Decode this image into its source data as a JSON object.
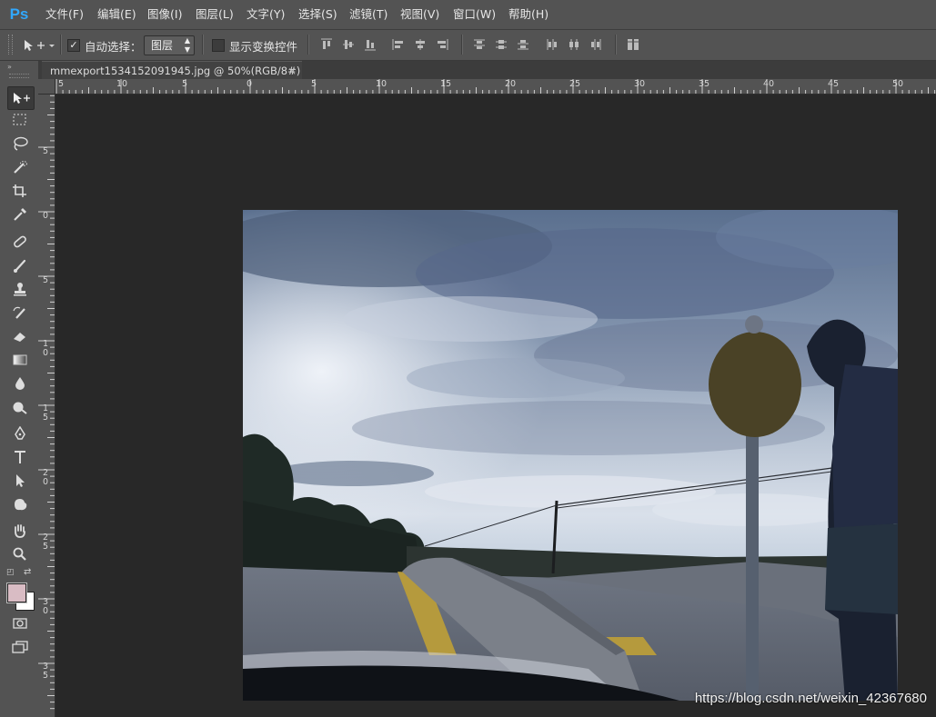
{
  "app": {
    "logo": "Ps"
  },
  "menu": [
    "文件(F)",
    "编辑(E)",
    "图像(I)",
    "图层(L)",
    "文字(Y)",
    "选择(S)",
    "滤镜(T)",
    "视图(V)",
    "窗口(W)",
    "帮助(H)"
  ],
  "options": {
    "auto_select_label": "自动选择：",
    "auto_select_checked": true,
    "auto_select_value": "图层",
    "show_transform_label": "显示变换控件",
    "show_transform_checked": false
  },
  "document": {
    "tab_title": "mmexport1534152091945.jpg @ 50%(RGB/8#)",
    "close_glyph": "×"
  },
  "rulers": {
    "horizontal": [
      "5",
      "10",
      "5",
      "0",
      "5",
      "10",
      "15",
      "20",
      "25",
      "30",
      "35",
      "40",
      "45",
      "50"
    ],
    "vertical": [
      "5",
      "0",
      "5",
      "10",
      "15",
      "20",
      "25",
      "30",
      "35"
    ]
  },
  "icons": {
    "tools": [
      "move-tool",
      "marquee-tool",
      "lasso-tool",
      "quick-select-tool",
      "crop-tool",
      "eyedropper-tool",
      "healing-brush-tool",
      "brush-tool",
      "clone-stamp-tool",
      "history-brush-tool",
      "eraser-tool",
      "gradient-tool",
      "blur-tool",
      "dodge-tool",
      "pen-tool",
      "type-tool",
      "path-selection-tool",
      "shape-tool",
      "hand-tool",
      "zoom-tool"
    ]
  },
  "colors": {
    "foreground": "#d9bcc4",
    "background": "#ffffff",
    "accent": "#31a8ff"
  },
  "watermark": "https://blog.csdn.net/weixin_42367680"
}
